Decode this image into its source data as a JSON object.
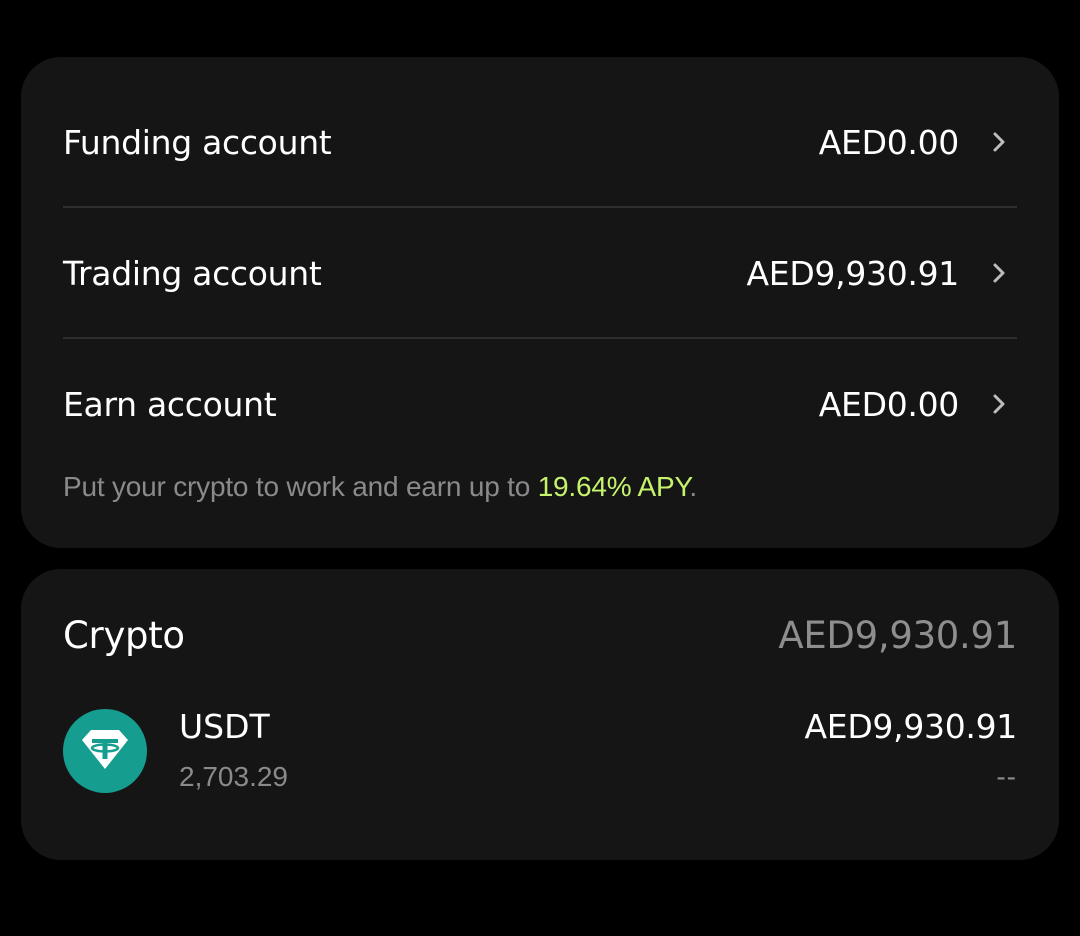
{
  "accounts": {
    "funding": {
      "label": "Funding account",
      "amount": "AED0.00"
    },
    "trading": {
      "label": "Trading account",
      "amount": "AED9,930.91"
    },
    "earn": {
      "label": "Earn account",
      "amount": "AED0.00"
    },
    "earn_note": {
      "prefix": "Put your crypto to work and earn up to ",
      "apy": "19.64% APY",
      "suffix": "."
    }
  },
  "crypto": {
    "title": "Crypto",
    "total": "AED9,930.91",
    "assets": [
      {
        "symbol": "USDT",
        "quantity": "2,703.29",
        "value": "AED9,930.91",
        "change": "--",
        "icon": "tether-icon",
        "icon_color": "#159d8f"
      }
    ]
  },
  "colors": {
    "background": "#000000",
    "card": "#151515",
    "accent_green": "#c6f36c",
    "muted_text": "#8a8a8a"
  }
}
